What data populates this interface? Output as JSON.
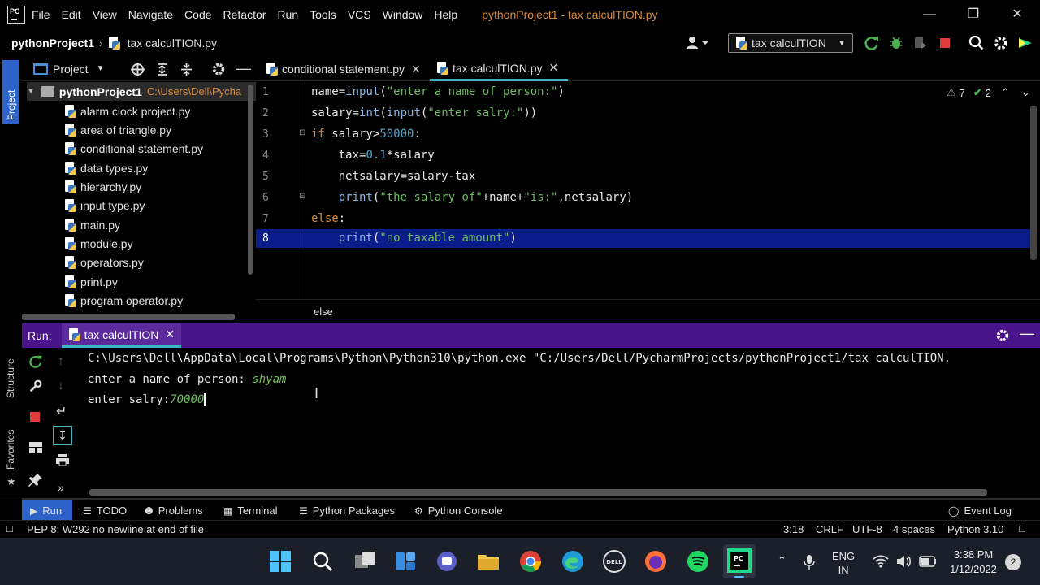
{
  "menubar": {
    "items": [
      "File",
      "Edit",
      "View",
      "Navigate",
      "Code",
      "Refactor",
      "Run",
      "Tools",
      "VCS",
      "Window",
      "Help"
    ],
    "window_title": "pythonProject1 - tax calculTION.py"
  },
  "navbar": {
    "project": "pythonProject1",
    "file": "tax calculTION.py",
    "run_config": "tax calculTION"
  },
  "left_stripe": {
    "project_label": "Project",
    "structure_label": "Structure",
    "favorites_label": "Favorites"
  },
  "project_panel": {
    "title": "Project",
    "root_name": "pythonProject1",
    "root_path": "C:\\Users\\Dell\\Pycha",
    "files": [
      "alarm clock project.py",
      "area of triangle.py",
      "conditional statement.py",
      "data types.py",
      "hierarchy.py",
      "input type.py",
      "main.py",
      "module.py",
      "operators.py",
      "print.py",
      "program operator.py"
    ]
  },
  "editor": {
    "tabs": [
      {
        "label": "conditional statement.py",
        "active": false
      },
      {
        "label": "tax calculTION.py",
        "active": true
      }
    ],
    "inspections": {
      "warnings": "7",
      "ok": "2"
    },
    "line_numbers": [
      "1",
      "2",
      "3",
      "4",
      "5",
      "6",
      "7",
      "8"
    ],
    "breadcrumb": "else"
  },
  "run": {
    "label": "Run:",
    "tab": "tax calculTION",
    "console": {
      "command": "C:\\Users\\Dell\\AppData\\Local\\Programs\\Python\\Python310\\python.exe \"C:/Users/Dell/PycharmProjects/pythonProject1/tax calculTION.",
      "prompt1": "enter a name of person: ",
      "input1": "shyam",
      "prompt2": "enter salry:",
      "input2": "70000"
    }
  },
  "bottom_tools": [
    "Run",
    "TODO",
    "Problems",
    "Terminal",
    "Python Packages",
    "Python Console",
    "Event Log"
  ],
  "statusbar": {
    "message": "PEP 8: W292 no newline at end of file",
    "position": "3:18",
    "line_sep": "CRLF",
    "encoding": "UTF-8",
    "indent": "4 spaces",
    "interpreter": "Python 3.10"
  },
  "taskbar": {
    "lang": "ENG",
    "region": "IN",
    "time": "3:38 PM",
    "date": "1/12/2022",
    "notifications": "2"
  },
  "colors": {
    "keyword": "#d48c3c",
    "string": "#6fba62",
    "number": "#58a6c9",
    "run_header": "#4a148c",
    "selection": "#0a1d8a"
  }
}
